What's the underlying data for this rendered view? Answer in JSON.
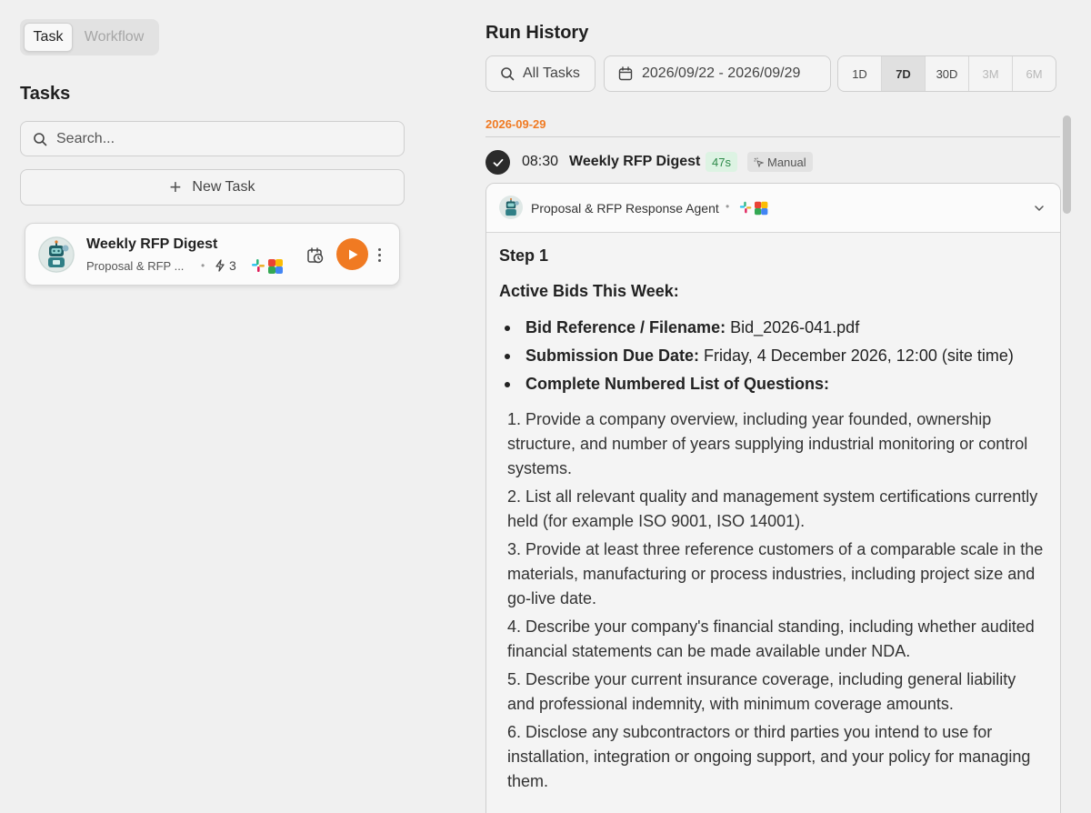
{
  "mode_switch": {
    "items": [
      {
        "label": "Task",
        "active": true
      },
      {
        "label": "Workflow",
        "active": false
      }
    ]
  },
  "tasks": {
    "title": "Tasks",
    "search": {
      "placeholder": "Search...",
      "icon": "search-icon"
    },
    "new_task_label": "New Task",
    "list": [
      {
        "title": "Weekly RFP Digest",
        "agent": "Proposal & RFP ...",
        "run_count": "3",
        "apps": [
          "slack-icon",
          "multi-app-icon"
        ],
        "play_color": "#f07a22"
      }
    ]
  },
  "run_history": {
    "title": "Run History",
    "filter_all_tasks": "All Tasks",
    "date_range": "2026/09/22 - 2026/09/29",
    "ranges": [
      {
        "label": "1D",
        "state": "normal"
      },
      {
        "label": "7D",
        "state": "active"
      },
      {
        "label": "30D",
        "state": "normal"
      },
      {
        "label": "3M",
        "state": "disabled"
      },
      {
        "label": "6M",
        "state": "disabled"
      }
    ],
    "groups": [
      {
        "date": "2026-09-29",
        "runs": [
          {
            "time": "08:30",
            "name": "Weekly RFP Digest",
            "duration": "47s",
            "trigger": "Manual",
            "status": "success",
            "output": {
              "agent_name": "Proposal & RFP Response Agent",
              "step": "Step 1",
              "heading": "Active Bids This Week:",
              "bullets": [
                {
                  "label": "Bid Reference / Filename:",
                  "value": " Bid_2026-041.pdf"
                },
                {
                  "label": "Submission Due Date:",
                  "value": " Friday, 4 December 2026, 12:00 (site time)"
                },
                {
                  "label": "Complete Numbered List of Questions:",
                  "value": ""
                }
              ],
              "questions": [
                "1. Provide a company overview, including year founded, ownership structure, and number of years supplying industrial monitoring or control systems.",
                "2. List all relevant quality and management system certifications currently held (for example ISO 9001, ISO 14001).",
                "3. Provide at least three reference customers of a comparable scale in the materials, manufacturing or process industries, including project size and go-live date.",
                "4. Describe your company's financial standing, including whether audited financial statements can be made available under NDA.",
                "5. Describe your current insurance coverage, including general liability and professional indemnity, with minimum coverage amounts.",
                "6. Disclose any subcontractors or third parties you intend to use for installation, integration or ongoing support, and your policy for managing them."
              ]
            }
          }
        ]
      }
    ]
  },
  "colors": {
    "accent": "#f07a22",
    "success_bg": "#ddf3e3",
    "success_text": "#2e8a4a",
    "background": "#f0f0f0"
  }
}
